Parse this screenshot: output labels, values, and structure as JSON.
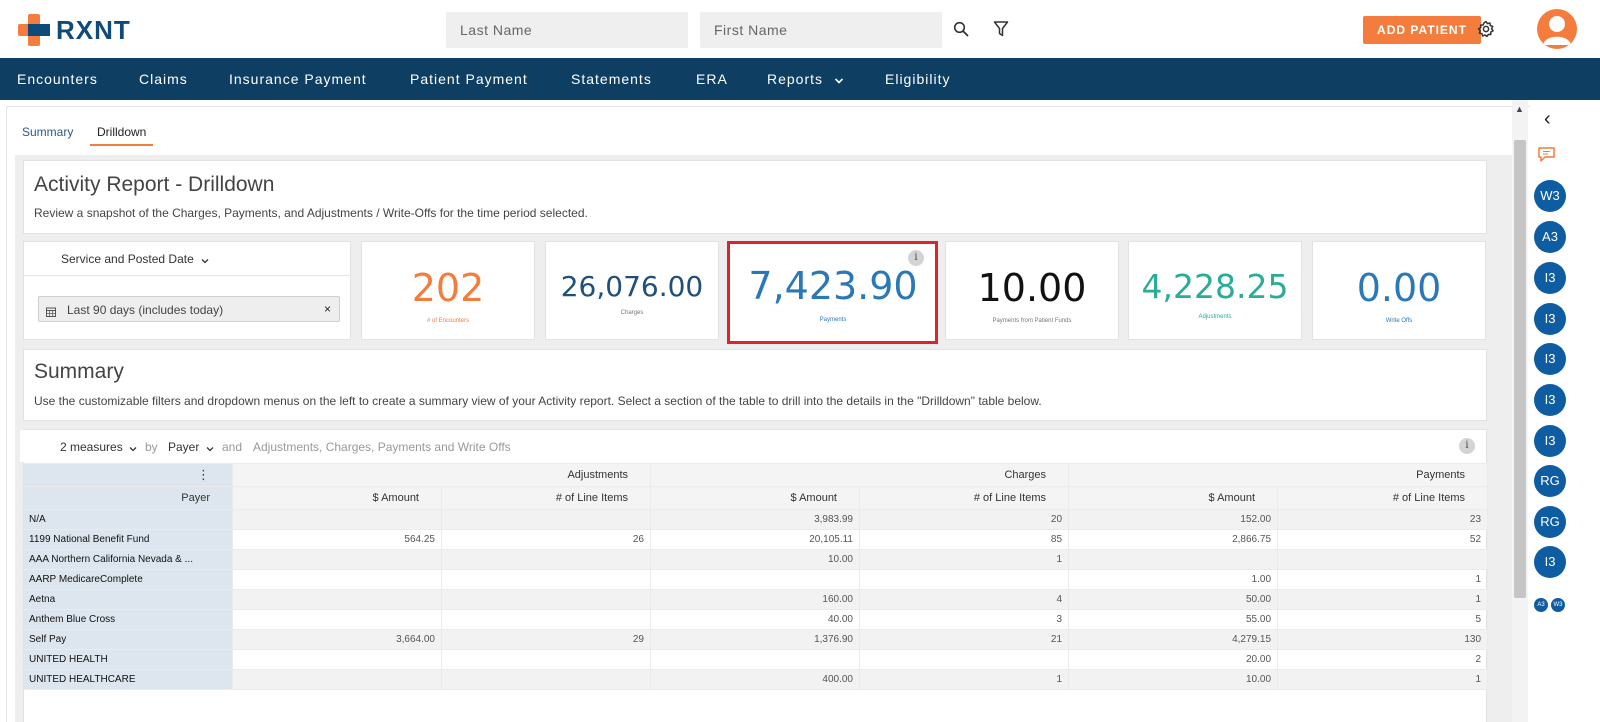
{
  "brand": {
    "name": "RXNT"
  },
  "search": {
    "last_name_placeholder": "Last Name",
    "first_name_placeholder": "First Name"
  },
  "header": {
    "add_patient_label": "ADD PATIENT"
  },
  "nav": {
    "encounters": "Encounters",
    "claims": "Claims",
    "insurance_payment": "Insurance Payment",
    "patient_payment": "Patient Payment",
    "statements": "Statements",
    "era": "ERA",
    "reports": "Reports",
    "eligibility": "Eligibility"
  },
  "tabs": {
    "summary": "Summary",
    "drilldown": "Drilldown"
  },
  "report": {
    "title": "Activity Report - Drilldown",
    "description": "Review a snapshot of the Charges, Payments, and Adjustments / Write-Offs for the time period selected."
  },
  "date_filter": {
    "label": "Service and Posted Date",
    "value": "Last 90 days (includes today)",
    "clear": "×"
  },
  "kpis": [
    {
      "value": "202",
      "label": "# of Encounters",
      "color": "#f47c3c"
    },
    {
      "value": "26,076.00",
      "label": "Charges",
      "color": "#1f4f7a"
    },
    {
      "value": "7,423.90",
      "label": "Payments",
      "color": "#2a78b8"
    },
    {
      "value": "10.00",
      "label": "Payments from Patient Funds",
      "color": "#111111"
    },
    {
      "value": "4,228.25",
      "label": "Adjustments",
      "color": "#2bac98"
    },
    {
      "value": "0.00",
      "label": "Write Offs",
      "color": "#2a78b8"
    }
  ],
  "info_glyph": "i",
  "summary": {
    "title": "Summary",
    "description": "Use the customizable filters and dropdown menus on the left to create a summary view of your Activity report. Select a section of the table to drill into the details in the \"Drilldown\" table below."
  },
  "pivot": {
    "measures": "2 measures",
    "by": "by",
    "payer": "Payer",
    "and": "and",
    "columns": "Adjustments, Charges, Payments and Write Offs",
    "menu_glyph": "⋮"
  },
  "table": {
    "row_header": "Payer",
    "groups": [
      "Adjustments",
      "Charges",
      "Payments"
    ],
    "sub_headers": [
      "$ Amount",
      "# of Line Items",
      "$ Amount",
      "# of Line Items",
      "$ Amount",
      "# of Line Items"
    ],
    "rows": [
      {
        "payer": "N/A",
        "cells": [
          "",
          "",
          "3,983.99",
          "20",
          "152.00",
          "23"
        ]
      },
      {
        "payer": "1199 National Benefit Fund",
        "cells": [
          "564.25",
          "26",
          "20,105.11",
          "85",
          "2,866.75",
          "52"
        ]
      },
      {
        "payer": "AAA Northern California Nevada & ...",
        "cells": [
          "",
          "",
          "10.00",
          "1",
          "",
          ""
        ]
      },
      {
        "payer": "AARP MedicareComplete",
        "cells": [
          "",
          "",
          "",
          "",
          "1.00",
          "1"
        ]
      },
      {
        "payer": "Aetna",
        "cells": [
          "",
          "",
          "160.00",
          "4",
          "50.00",
          "1"
        ]
      },
      {
        "payer": "Anthem Blue Cross",
        "cells": [
          "",
          "",
          "40.00",
          "3",
          "55.00",
          "5"
        ]
      },
      {
        "payer": "Self Pay",
        "cells": [
          "3,664.00",
          "29",
          "1,376.90",
          "21",
          "4,279.15",
          "130"
        ]
      },
      {
        "payer": "UNITED HEALTH",
        "cells": [
          "",
          "",
          "",
          "",
          "20.00",
          "2"
        ]
      },
      {
        "payer": "UNITED HEALTHCARE",
        "cells": [
          "",
          "",
          "400.00",
          "1",
          "10.00",
          "1"
        ]
      }
    ]
  },
  "rail": {
    "collapse_glyph": "‹",
    "badges": [
      "W3",
      "A3",
      "I3",
      "I3",
      "I3",
      "I3",
      "I3",
      "RG",
      "RG",
      "I3"
    ],
    "mini_badges": [
      "A3",
      "W3"
    ]
  },
  "scroll": {
    "up_glyph": "▲"
  }
}
